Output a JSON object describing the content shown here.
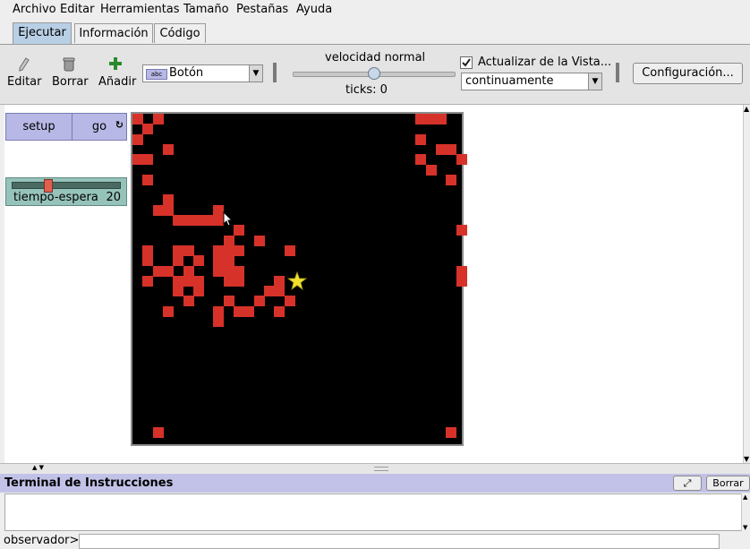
{
  "menubar": {
    "items": [
      "Archivo",
      "Editar",
      "Herramientas",
      "Tamaño",
      "Pestañas",
      "Ayuda"
    ]
  },
  "tabs": [
    {
      "label": "Ejecutar",
      "active": true
    },
    {
      "label": "Información",
      "active": false
    },
    {
      "label": "Código",
      "active": false
    }
  ],
  "toolbar": {
    "edit_label": "Editar",
    "delete_label": "Borrar",
    "add_label": "Añadir",
    "widget_type_value": "Botón",
    "widget_type_icon": "abc",
    "speed_label": "velocidad normal",
    "speed_value": 0.5,
    "ticks_text": "ticks: 0",
    "update_checkbox_label": "Actualizar de la Vista...",
    "update_checked": true,
    "update_mode_value": "continuamente",
    "settings_label": "Configuración..."
  },
  "widgets": {
    "setup_label": "setup",
    "go_label": "go",
    "slider_name": "tiempo-espera",
    "slider_value": "20",
    "slider_position": 0.3
  },
  "world": {
    "background": "#000000",
    "patch_color": "#d73229",
    "turtle_color": "#f0e030"
  },
  "terminal": {
    "title": "Terminal de Instrucciones",
    "clear_label": "Borrar",
    "prompt_label": "observador>",
    "command_value": ""
  }
}
